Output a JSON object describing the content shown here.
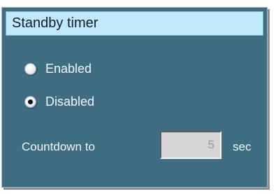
{
  "panel": {
    "title": "Standby timer"
  },
  "options": {
    "enabled_label": "Enabled",
    "disabled_label": "Disabled",
    "selected": "Disabled"
  },
  "countdown": {
    "label": "Countdown to",
    "value": "5",
    "unit": "sec",
    "disabled": true
  },
  "colors": {
    "panel_bg": "#3f6e84",
    "header_bg": "#bfe9fb",
    "input_bg": "#d6d6d6",
    "label_text": "#f2f6f8"
  }
}
